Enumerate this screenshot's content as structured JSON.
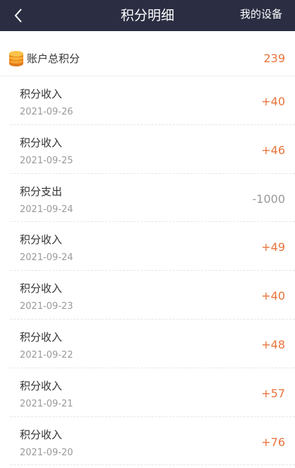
{
  "header": {
    "title": "积分明细",
    "right_link": "我的设备"
  },
  "summary": {
    "label": "账户总积分",
    "value": "239"
  },
  "records": [
    {
      "title": "积分收入",
      "date": "2021-09-26",
      "amount": "+40",
      "type": "income"
    },
    {
      "title": "积分收入",
      "date": "2021-09-25",
      "amount": "+46",
      "type": "income"
    },
    {
      "title": "积分支出",
      "date": "2021-09-24",
      "amount": "-1000",
      "type": "expense"
    },
    {
      "title": "积分收入",
      "date": "2021-09-24",
      "amount": "+49",
      "type": "income"
    },
    {
      "title": "积分收入",
      "date": "2021-09-23",
      "amount": "+40",
      "type": "income"
    },
    {
      "title": "积分收入",
      "date": "2021-09-22",
      "amount": "+48",
      "type": "income"
    },
    {
      "title": "积分收入",
      "date": "2021-09-21",
      "amount": "+57",
      "type": "income"
    },
    {
      "title": "积分收入",
      "date": "2021-09-20",
      "amount": "+76",
      "type": "income"
    }
  ],
  "icons": {
    "back": "chevron-left-icon",
    "coin": "coin-stack-icon"
  },
  "colors": {
    "header_bg": "#2b2e42",
    "accent": "#e8733a",
    "expense": "#999999"
  }
}
